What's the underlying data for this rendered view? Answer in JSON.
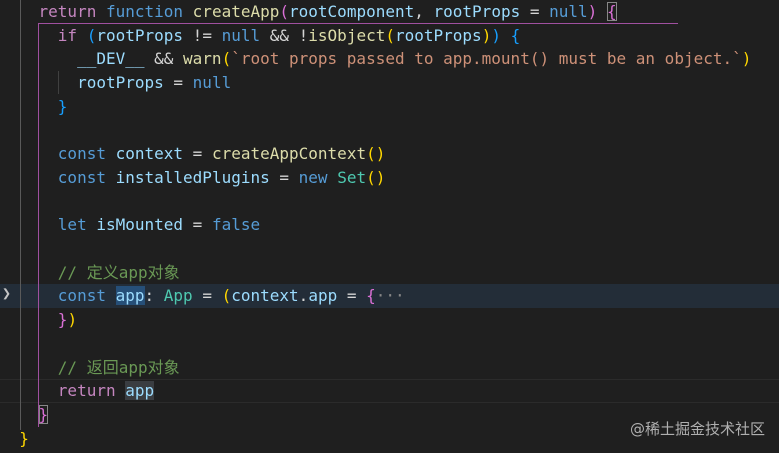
{
  "lines": [
    [
      [
        "    ",
        "op"
      ],
      [
        "return",
        "kw"
      ],
      [
        " ",
        "op"
      ],
      [
        "function",
        "st"
      ],
      [
        " ",
        "op"
      ],
      [
        "createApp",
        "fn"
      ],
      [
        "(",
        "b2"
      ],
      [
        "rootComponent",
        "vr"
      ],
      [
        ", ",
        "op"
      ],
      [
        "rootProps",
        "vr"
      ],
      [
        " = ",
        "op"
      ],
      [
        "null",
        "st"
      ],
      [
        ")",
        "b2"
      ],
      [
        " ",
        "op"
      ],
      [
        "{",
        "b2 box"
      ]
    ],
    [
      [
        "      ",
        "op"
      ],
      [
        "if",
        "kw"
      ],
      [
        " ",
        "op"
      ],
      [
        "(",
        "b3"
      ],
      [
        "rootProps",
        "vr"
      ],
      [
        " != ",
        "op"
      ],
      [
        "null",
        "st"
      ],
      [
        " && !",
        "op"
      ],
      [
        "isObject",
        "fn"
      ],
      [
        "(",
        "b1"
      ],
      [
        "rootProps",
        "vr"
      ],
      [
        ")",
        "b1"
      ],
      [
        ")",
        "b3"
      ],
      [
        " ",
        "op"
      ],
      [
        "{",
        "b3"
      ]
    ],
    [
      [
        "        ",
        "op"
      ],
      [
        "__DEV__",
        "vr"
      ],
      [
        " && ",
        "op"
      ],
      [
        "warn",
        "fn"
      ],
      [
        "(",
        "b1"
      ],
      [
        "`root props passed to app.mount() must be an object.`",
        "str"
      ],
      [
        ")",
        "b1"
      ]
    ],
    [
      [
        "        ",
        "op"
      ],
      [
        "rootProps",
        "vr"
      ],
      [
        " = ",
        "op"
      ],
      [
        "null",
        "st"
      ]
    ],
    [
      [
        "      ",
        "op"
      ],
      [
        "}",
        "b3"
      ]
    ],
    [],
    [
      [
        "      ",
        "op"
      ],
      [
        "const",
        "st"
      ],
      [
        " ",
        "op"
      ],
      [
        "context",
        "vr"
      ],
      [
        " = ",
        "op"
      ],
      [
        "createAppContext",
        "fn"
      ],
      [
        "()",
        "b1"
      ]
    ],
    [
      [
        "      ",
        "op"
      ],
      [
        "const",
        "st"
      ],
      [
        " ",
        "op"
      ],
      [
        "installedPlugins",
        "vr"
      ],
      [
        " = ",
        "op"
      ],
      [
        "new",
        "st"
      ],
      [
        " ",
        "op"
      ],
      [
        "Set",
        "ty"
      ],
      [
        "()",
        "b1"
      ]
    ],
    [],
    [
      [
        "      ",
        "op"
      ],
      [
        "let",
        "st"
      ],
      [
        " ",
        "op"
      ],
      [
        "isMounted",
        "vr"
      ],
      [
        " = ",
        "op"
      ],
      [
        "false",
        "st"
      ]
    ],
    [],
    [
      [
        "      ",
        "op"
      ],
      [
        "// 定义app对象",
        "cm"
      ]
    ],
    [
      [
        "      ",
        "op"
      ],
      [
        "const",
        "st"
      ],
      [
        " ",
        "op"
      ],
      [
        "app",
        "vr sel"
      ],
      [
        ": ",
        "op"
      ],
      [
        "App",
        "ty"
      ],
      [
        " = ",
        "op"
      ],
      [
        "(",
        "b1"
      ],
      [
        "context",
        "vr"
      ],
      [
        ".",
        "op"
      ],
      [
        "app",
        "vr"
      ],
      [
        " = ",
        "op"
      ],
      [
        "{",
        "b2"
      ],
      [
        "···",
        "fold"
      ]
    ],
    [
      [
        "      ",
        "op"
      ],
      [
        "}",
        "b2"
      ],
      [
        ")",
        "b1"
      ]
    ],
    [],
    [
      [
        "      ",
        "op"
      ],
      [
        "// 返回app对象",
        "cm"
      ]
    ],
    [
      [
        "      ",
        "op"
      ],
      [
        "return",
        "kw"
      ],
      [
        " ",
        "op"
      ],
      [
        "app",
        "vr hl"
      ]
    ],
    [
      [
        "    ",
        "op"
      ],
      [
        "}",
        "b2 box"
      ]
    ],
    [
      [
        "  ",
        "op"
      ],
      [
        "}",
        "b1"
      ]
    ]
  ],
  "gutter": {
    "folded_line_icon": "chevron-right-icon"
  },
  "watermark": "@稀土掘金技术社区"
}
